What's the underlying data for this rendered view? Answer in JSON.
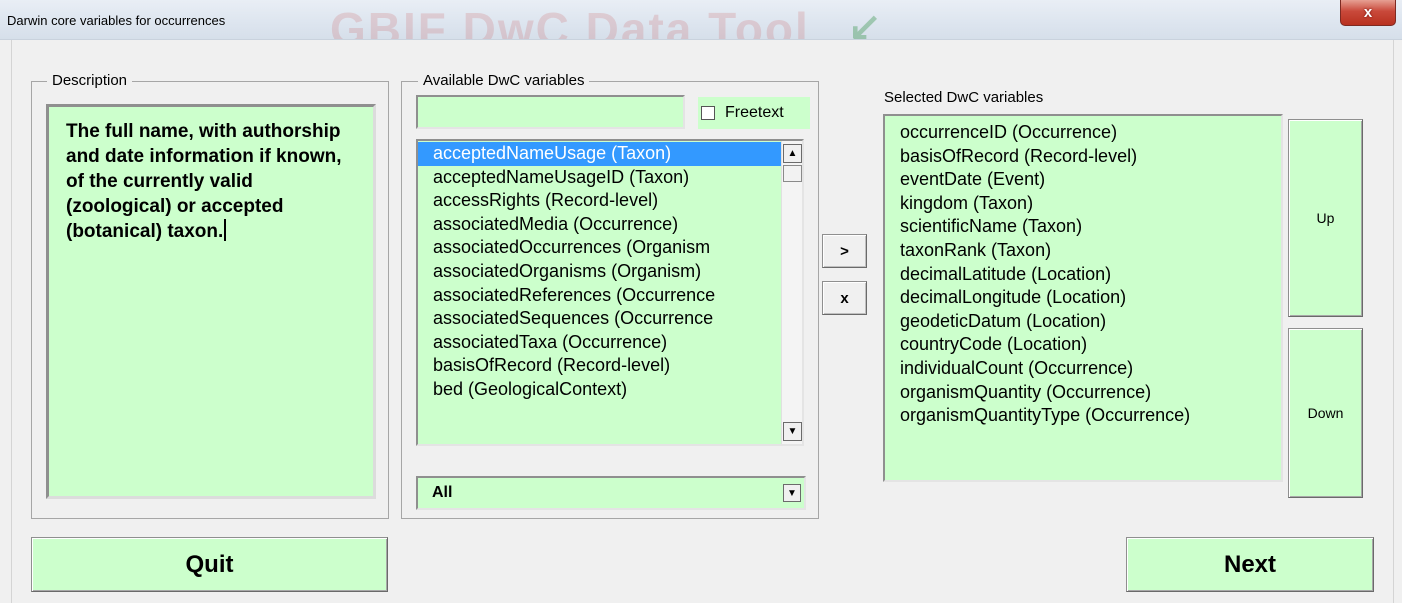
{
  "window": {
    "title": "Darwin core variables for occurrences",
    "close_label": "x",
    "watermark": "GBIF DwC Data Tool"
  },
  "description": {
    "label": "Description",
    "text": "The full name, with authorship and date information if known, of the currently valid (zoological) or accepted (botanical) taxon."
  },
  "available": {
    "label": "Available DwC variables",
    "search_value": "",
    "freetext_label": "Freetext",
    "freetext_checked": false,
    "items": [
      "acceptedNameUsage (Taxon)",
      "acceptedNameUsageID (Taxon)",
      "accessRights (Record-level)",
      "associatedMedia (Occurrence)",
      "associatedOccurrences (Organism",
      "associatedOrganisms (Organism)",
      "associatedReferences (Occurrence",
      "associatedSequences (Occurrence",
      "associatedTaxa (Occurrence)",
      "basisOfRecord (Record-level)",
      "bed (GeologicalContext)"
    ],
    "selected_index": 0,
    "filter_value": "All"
  },
  "transfer": {
    "add_label": ">",
    "remove_label": "x"
  },
  "selected": {
    "label": "Selected DwC variables",
    "items": [
      "occurrenceID (Occurrence)",
      "basisOfRecord (Record-level)",
      "eventDate (Event)",
      "kingdom (Taxon)",
      "scientificName (Taxon)",
      "taxonRank (Taxon)",
      "decimalLatitude (Location)",
      "decimalLongitude (Location)",
      "geodeticDatum (Location)",
      "countryCode (Location)",
      "individualCount (Occurrence)",
      "organismQuantity (Occurrence)",
      "organismQuantityType (Occurrence)"
    ],
    "up_label": "Up",
    "down_label": "Down"
  },
  "footer": {
    "quit_label": "Quit",
    "next_label": "Next"
  },
  "colors": {
    "field_bg": "#ccffcc",
    "selection": "#3399ff",
    "close_button": "#c9493a"
  }
}
